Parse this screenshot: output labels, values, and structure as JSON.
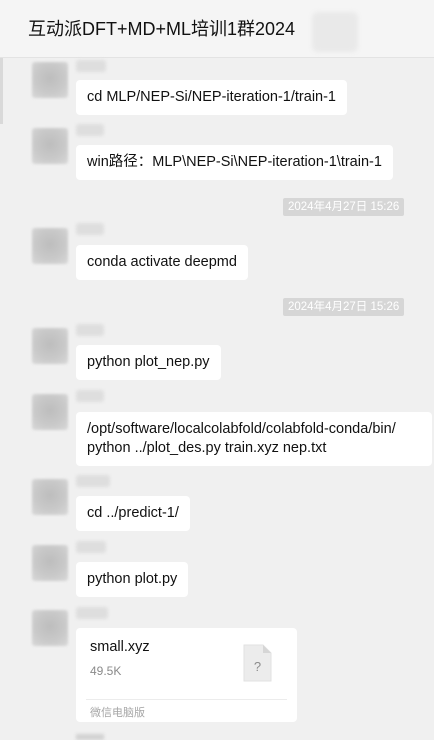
{
  "header": {
    "title": "互动派DFT+MD+ML培训1群2024"
  },
  "messages": [
    {
      "text": "cd MLP/NEP-Si/NEP-iteration-1/train-1"
    },
    {
      "text": "win路径：MLP\\NEP-Si\\NEP-iteration-1\\train-1"
    },
    {
      "timestamp": "2024年4月27日 15:26"
    },
    {
      "text": "conda activate deepmd"
    },
    {
      "timestamp": "2024年4月27日 15:26"
    },
    {
      "text": "python plot_nep.py"
    },
    {
      "lines": [
        "/opt/software/localcolabfold/colabfold-conda/bin/",
        "python ../plot_des.py train.xyz nep.txt"
      ]
    },
    {
      "text": "cd ../predict-1/"
    },
    {
      "text": "python plot.py"
    },
    {
      "file": {
        "name": "small.xyz",
        "size": "49.5K",
        "icon_glyph": "?",
        "source": "微信电脑版"
      }
    }
  ],
  "icons": {
    "file": "unknown-file-icon"
  },
  "colors": {
    "chat_background": "#f0f0f0",
    "bubble": "#ffffff",
    "timestamp_bg": "#d6d6d6"
  }
}
